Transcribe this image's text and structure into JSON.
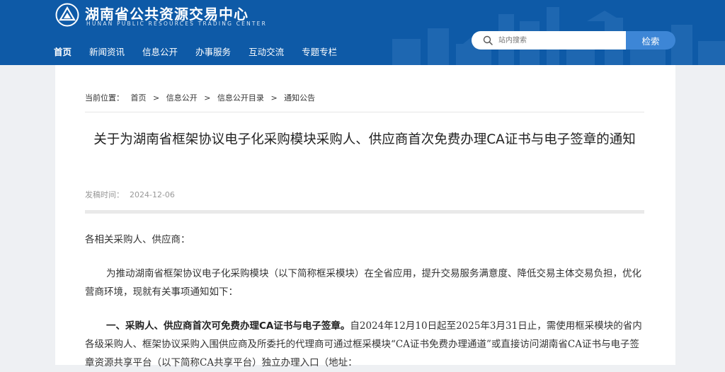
{
  "header": {
    "site_title": "湖南省公共资源交易中心",
    "site_subtitle": "HUNAN PUBLIC RESOURCES TRADING CENTER",
    "nav": [
      "首页",
      "新闻资讯",
      "信息公开",
      "办事服务",
      "互动交流",
      "专题专栏"
    ],
    "search": {
      "placeholder": "站内搜索",
      "button_label": "检索"
    }
  },
  "breadcrumb": {
    "prefix": "当前位置：",
    "items": [
      "首页",
      "信息公开",
      "信息公开目录",
      "通知公告"
    ],
    "separator": ">"
  },
  "article": {
    "title": "关于为湖南省框架协议电子化采购模块采购人、供应商首次免费办理CA证书与电子签章的通知",
    "pubdate_label": "发稿时间：",
    "pubdate": "2024-12-06",
    "greeting": "各相关采购人、供应商：",
    "intro": "为推动湖南省框架协议电子化采购模块（以下简称框采模块）在全省应用，提升交易服务满意度、降低交易主体交易负担，优化营商环境，现就有关事项通知如下：",
    "section1_heading": "一、采购人、供应商首次可免费办理CA证书与电子签章。",
    "section1_text": "自2024年12月10日起至2025年3月31日止，需使用框采模块的省内各级采购人、框架协议采购入围供应商及所委托的代理商可通过框采模块“CA证书免费办理通道”或直接访问湖南省CA证书与电子签章资源共享平台（以下简称CA共享平台）独立办理入口（地址："
  },
  "colors": {
    "header_bg": "#0e5aa7",
    "search_button": "#3d86d6",
    "page_bg": "#eef0f3"
  }
}
